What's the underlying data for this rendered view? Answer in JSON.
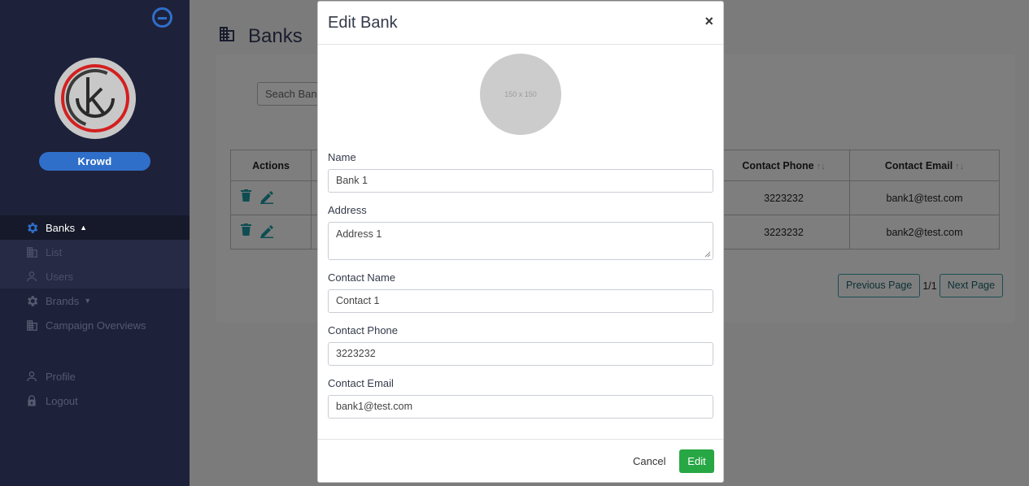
{
  "sidebar": {
    "user_name": "Krowd",
    "items": [
      {
        "label": "Banks",
        "icon": "gear-icon"
      },
      {
        "label": "List",
        "icon": "building-icon"
      },
      {
        "label": "Users",
        "icon": "user-icon"
      },
      {
        "label": "Brands",
        "icon": "gear-icon"
      },
      {
        "label": "Campaign Overviews",
        "icon": "building-icon"
      }
    ],
    "footer_items": [
      {
        "label": "Profile",
        "icon": "user-icon"
      },
      {
        "label": "Logout",
        "icon": "lock-icon"
      }
    ]
  },
  "page": {
    "title": "Banks",
    "search_placeholder": "Seach  Ban"
  },
  "table": {
    "headers": [
      "Actions",
      "Contact Phone",
      "Contact Email"
    ],
    "rows": [
      {
        "phone": "3223232",
        "email": "bank1@test.com"
      },
      {
        "phone": "3223232",
        "email": "bank2@test.com"
      }
    ]
  },
  "pager": {
    "prev": "Previous Page",
    "info": "1/1",
    "next": "Next Page"
  },
  "modal": {
    "title": "Edit Bank",
    "close": "×",
    "avatar_text": "150 x 150",
    "fields": [
      {
        "label": "Name",
        "value": "Bank 1"
      },
      {
        "label": "Address",
        "value": "Address 1"
      },
      {
        "label": "Contact Name",
        "value": "Contact 1"
      },
      {
        "label": "Contact Phone",
        "value": "3223232"
      },
      {
        "label": "Contact Email",
        "value": "bank1@test.com"
      }
    ],
    "cancel": "Cancel",
    "submit": "Edit"
  },
  "colors": {
    "sidebar": "#1e213a",
    "accent": "#2f6fc9",
    "success": "#28a745",
    "teal": "#1a7c84"
  }
}
